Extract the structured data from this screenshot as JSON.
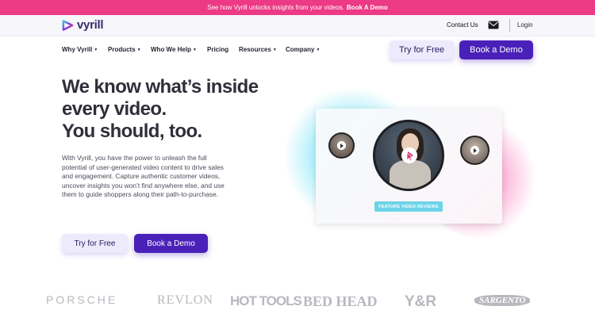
{
  "promo": {
    "text": "See how Vyrill unlocks insights from your videos.",
    "link": "Book A Demo",
    "color": "#ec3a84"
  },
  "topbar": {
    "logo_text": "vyrill",
    "contact": "Contact Us",
    "login": "Login"
  },
  "nav": {
    "items": [
      {
        "label": "Why Vyrill",
        "dropdown": true
      },
      {
        "label": "Products",
        "dropdown": true
      },
      {
        "label": "Who We Help",
        "dropdown": true
      },
      {
        "label": "Pricing",
        "dropdown": false
      },
      {
        "label": "Resources",
        "dropdown": true
      },
      {
        "label": "Company",
        "dropdown": true
      }
    ],
    "try_label": "Try for Free",
    "demo_label": "Book a Demo"
  },
  "hero": {
    "headline": [
      "We know what’s inside",
      "every video.",
      "You should, too."
    ],
    "body": "With Vyrill, you have the power to unleash the full potential of user-generated video content to drive sales and engagement. Capture authentic customer videos, uncover insights you won’t find anywhere else, and use them to guide shoppers along their path-to-purchase.",
    "try_label": "Try for Free",
    "demo_label": "Book a Demo"
  },
  "illustration": {
    "badge": "FEATURE VIDEO REVIEWS"
  },
  "brands": [
    "PORSCHE",
    "REVLON",
    "HOT TOOLS",
    "BED HEAD",
    "Y&R",
    "SARGENTO"
  ],
  "colors": {
    "accent": "#4a21b8",
    "pink": "#ec3a84",
    "cyan": "#6ed3e8"
  }
}
